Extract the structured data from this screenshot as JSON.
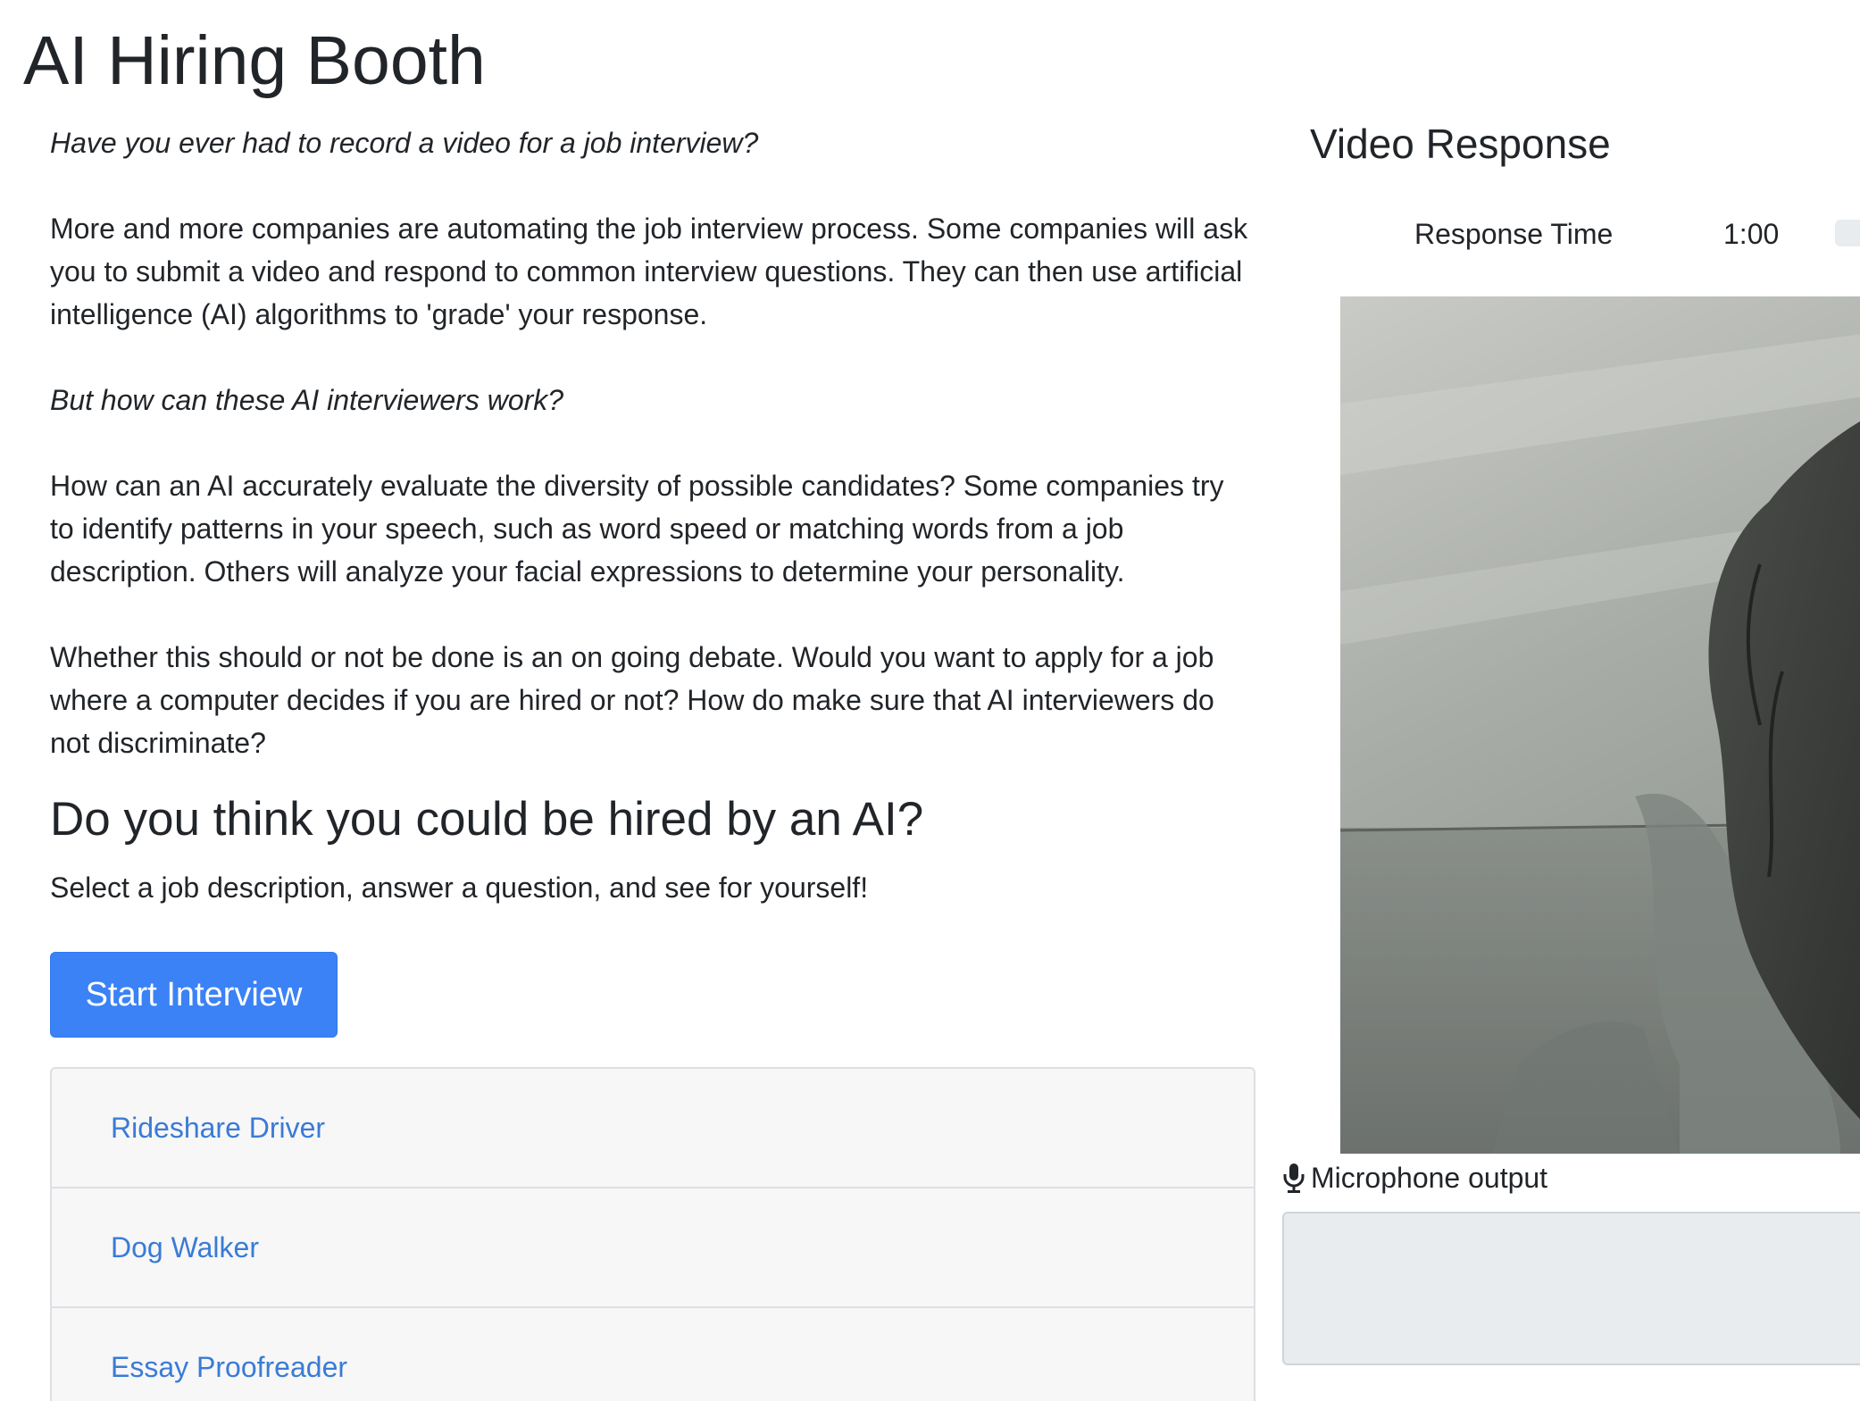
{
  "header": {
    "title": "AI Hiring Booth"
  },
  "intro": {
    "paragraphs": [
      "Have you ever had to record a video for a job interview?",
      "More and more companies are automating the job interview process. Some companies will ask you to submit a video and respond to common interview questions. They can then use artificial intelligence (AI) algorithms to 'grade' your response.",
      "But how can these AI interviewers work?",
      "How can an AI accurately evaluate the diversity of possible candidates? Some companies try to identify patterns in your speech, such as word speed or matching words from a job description. Others will analyze your facial expressions to determine your personality.",
      "Whether this should or not be done is an on going debate. Would you want to apply for a job where a computer decides if you are hired or not? How do make sure that AI interviewers do not discriminate?"
    ]
  },
  "cta": {
    "heading": "Do you think you could be hired by an AI?",
    "subtext": "Select a job description, answer a question, and see for yourself!",
    "start_button": "Start Interview"
  },
  "jobs": [
    "Rideshare Driver",
    "Dog Walker",
    "Essay Proofreader"
  ],
  "video_panel": {
    "heading": "Video Response",
    "response_time_label": "Response Time",
    "response_time_value": "1:00",
    "mic_label": "Microphone output",
    "mic_icon": "microphone-icon"
  },
  "colors": {
    "primary_button": "#3b82f6",
    "link": "#3a7bd5",
    "text": "#212529",
    "list_background": "#f7f7f8",
    "mic_output_background": "#e9ecef"
  }
}
